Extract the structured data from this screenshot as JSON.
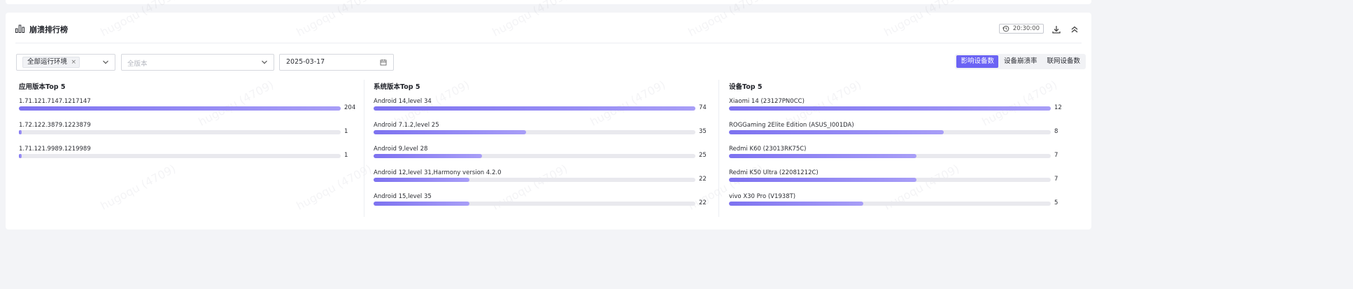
{
  "panel": {
    "title": "崩溃排行榜",
    "time": "20:30:00"
  },
  "filters": {
    "env_tag": "全部运行环境",
    "version_placeholder": "全版本",
    "date": "2025-03-17"
  },
  "metric_tabs": [
    {
      "label": "影响设备数",
      "active": true
    },
    {
      "label": "设备崩溃率",
      "active": false
    },
    {
      "label": "联网设备数",
      "active": false
    }
  ],
  "watermark": "hugoqu (4709)",
  "colors": {
    "accent": "#6b63f4",
    "bar_start": "#7d72f0",
    "bar_end": "#a89ef7",
    "track": "#e9e9ee"
  },
  "chart_data": [
    {
      "type": "bar",
      "title": "应用版本Top 5",
      "categories": [
        "1.71.121.7147.1217147",
        "1.72.122.3879.1223879",
        "1.71.121.9989.1219989"
      ],
      "values": [
        204,
        1,
        1
      ]
    },
    {
      "type": "bar",
      "title": "系统版本Top 5",
      "categories": [
        "Android 14,level 34",
        "Android 7.1.2,level 25",
        "Android 9,level 28",
        "Android 12,level 31,Harmony version 4.2.0",
        "Android 15,level 35"
      ],
      "values": [
        74,
        35,
        25,
        22,
        22
      ]
    },
    {
      "type": "bar",
      "title": "设备Top 5",
      "categories": [
        "Xiaomi 14 (23127PN0CC)",
        "ROGGaming 2Elite Edition (ASUS_I001DA)",
        "Redmi K60 (23013RK75C)",
        "Redmi K50 Ultra (22081212C)",
        "vivo X30 Pro (V1938T)"
      ],
      "values": [
        12,
        8,
        7,
        7,
        5
      ]
    }
  ]
}
